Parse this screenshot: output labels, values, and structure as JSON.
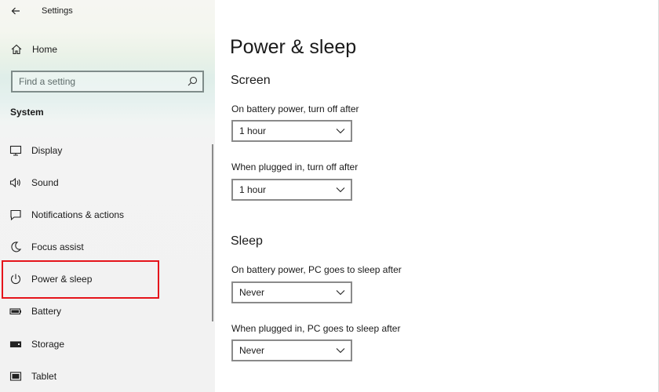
{
  "window": {
    "title": "Settings"
  },
  "sidebar": {
    "home_label": "Home",
    "search": {
      "placeholder": "Find a setting"
    },
    "section_title": "System",
    "items": [
      {
        "label": "Display",
        "icon": "display-icon"
      },
      {
        "label": "Sound",
        "icon": "speaker-icon"
      },
      {
        "label": "Notifications & actions",
        "icon": "notification-icon"
      },
      {
        "label": "Focus assist",
        "icon": "moon-icon"
      },
      {
        "label": "Power & sleep",
        "icon": "power-icon",
        "selected": true
      },
      {
        "label": "Battery",
        "icon": "battery-icon"
      },
      {
        "label": "Storage",
        "icon": "storage-icon"
      },
      {
        "label": "Tablet",
        "icon": "tablet-icon"
      }
    ]
  },
  "main": {
    "page_title": "Power & sleep",
    "screen": {
      "title": "Screen",
      "battery_label": "On battery power, turn off after",
      "battery_value": "1 hour",
      "plugged_label": "When plugged in, turn off after",
      "plugged_value": "1 hour"
    },
    "sleep": {
      "title": "Sleep",
      "battery_label": "On battery power, PC goes to sleep after",
      "battery_value": "Never",
      "plugged_label": "When plugged in, PC goes to sleep after",
      "plugged_value": "Never"
    }
  },
  "colors": {
    "highlight": "#e5141b",
    "border": "#8a8a8a"
  }
}
